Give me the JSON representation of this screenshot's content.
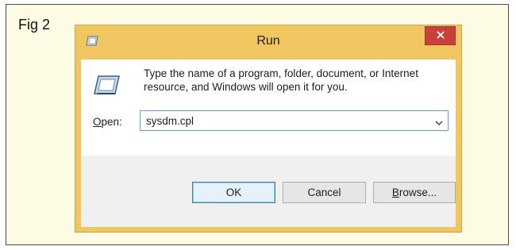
{
  "figure": {
    "label": "Fig 2"
  },
  "window": {
    "title": "Run",
    "frame_color": "#f0c660",
    "close_button_color": "#c7403a",
    "app_icon": "run-icon",
    "close_icon": "close-icon"
  },
  "dialog": {
    "description": "Type the name of a program, folder, document, or Internet resource, and Windows will open it for you.",
    "open_label": {
      "mnemonic": "O",
      "rest": "pen:"
    },
    "command": {
      "value": "sysdm.cpl",
      "dropdown_icon": "chevron-down-icon"
    }
  },
  "buttons": {
    "ok": "OK",
    "cancel": "Cancel",
    "browse": {
      "mnemonic": "B",
      "rest": "rowse..."
    }
  }
}
